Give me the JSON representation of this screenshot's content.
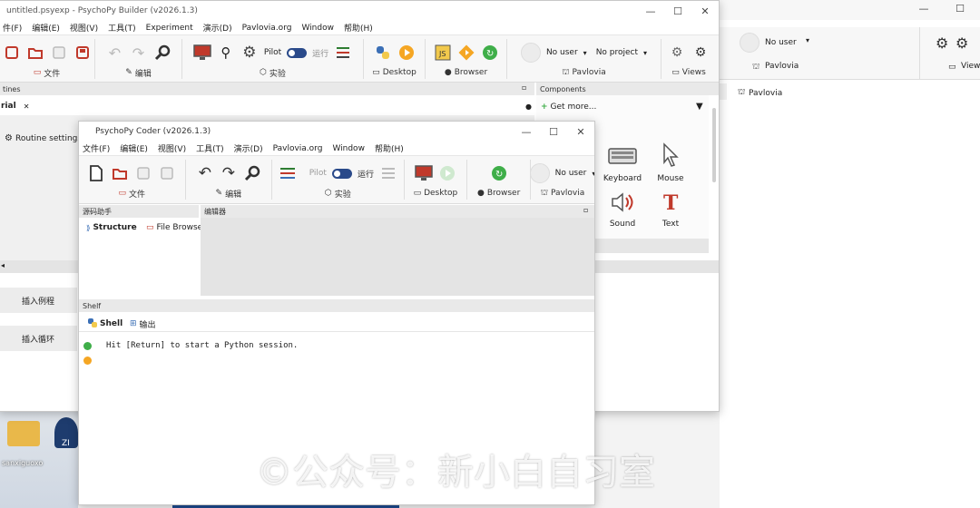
{
  "builder": {
    "title": "untitled.psyexp - PsychoPy Builder (v2026.1.3)",
    "menu": [
      "件(F)",
      "编辑(E)",
      "视图(V)",
      "工具(T)",
      "Experiment",
      "演示(D)",
      "Pavlovia.org",
      "Window",
      "帮助(H)"
    ],
    "group_labels": {
      "file": "文件",
      "edit": "编辑",
      "experiment": "实验",
      "desktop": "Desktop",
      "browser": "Browser",
      "pavlovia": "Pavlovia",
      "views": "Views"
    },
    "pilot_label": "Pilot",
    "run_label": "运行",
    "user": "No user",
    "project": "No project",
    "routines_header": "tines",
    "components_header": "Components",
    "routine_tab": "rial",
    "routine_settings": "Routine settings",
    "get_more": "Get more...",
    "insert_routine": "插入例程",
    "insert_loop": "插入循环",
    "components": [
      {
        "name": "Keyboard"
      },
      {
        "name": "Mouse"
      },
      {
        "name": "Sound"
      },
      {
        "name": "Text"
      }
    ]
  },
  "right_window": {
    "user": "No user",
    "pavlovia_label": "Pavlovia",
    "views_label": "View",
    "pavlovia_item": "Pavlovia"
  },
  "coder": {
    "title": "PsychoPy Coder (v2026.1.3)",
    "menu": [
      "文件(F)",
      "编辑(E)",
      "视图(V)",
      "工具(T)",
      "演示(D)",
      "Pavlovia.org",
      "Window",
      "帮助(H)"
    ],
    "group_labels": {
      "file": "文件",
      "edit": "编辑",
      "experiment": "实验",
      "desktop": "Desktop",
      "browser": "Browser",
      "pavlovia": "Pavlovia"
    },
    "pilot_label": "Pilot",
    "run_label": "运行",
    "user": "No user",
    "source_assistant": "源码助手",
    "editor": "编辑器",
    "structure_tab": "Structure",
    "file_browser_tab": "File Browse",
    "shelf": "Shelf",
    "shell_tab": "Shell",
    "output_tab": "输出",
    "shell_message": "Hit [Return] to start a Python session."
  },
  "desktop": {
    "icons": [
      {
        "label": "sanxiguoxo"
      },
      {
        "label": "ZI"
      }
    ]
  },
  "watermark": "©公众号：新小白自习室",
  "colors": {
    "accent": "#2a4a8a",
    "run_orange": "#f5a623",
    "green": "#3fae49",
    "red": "#d9362b"
  }
}
